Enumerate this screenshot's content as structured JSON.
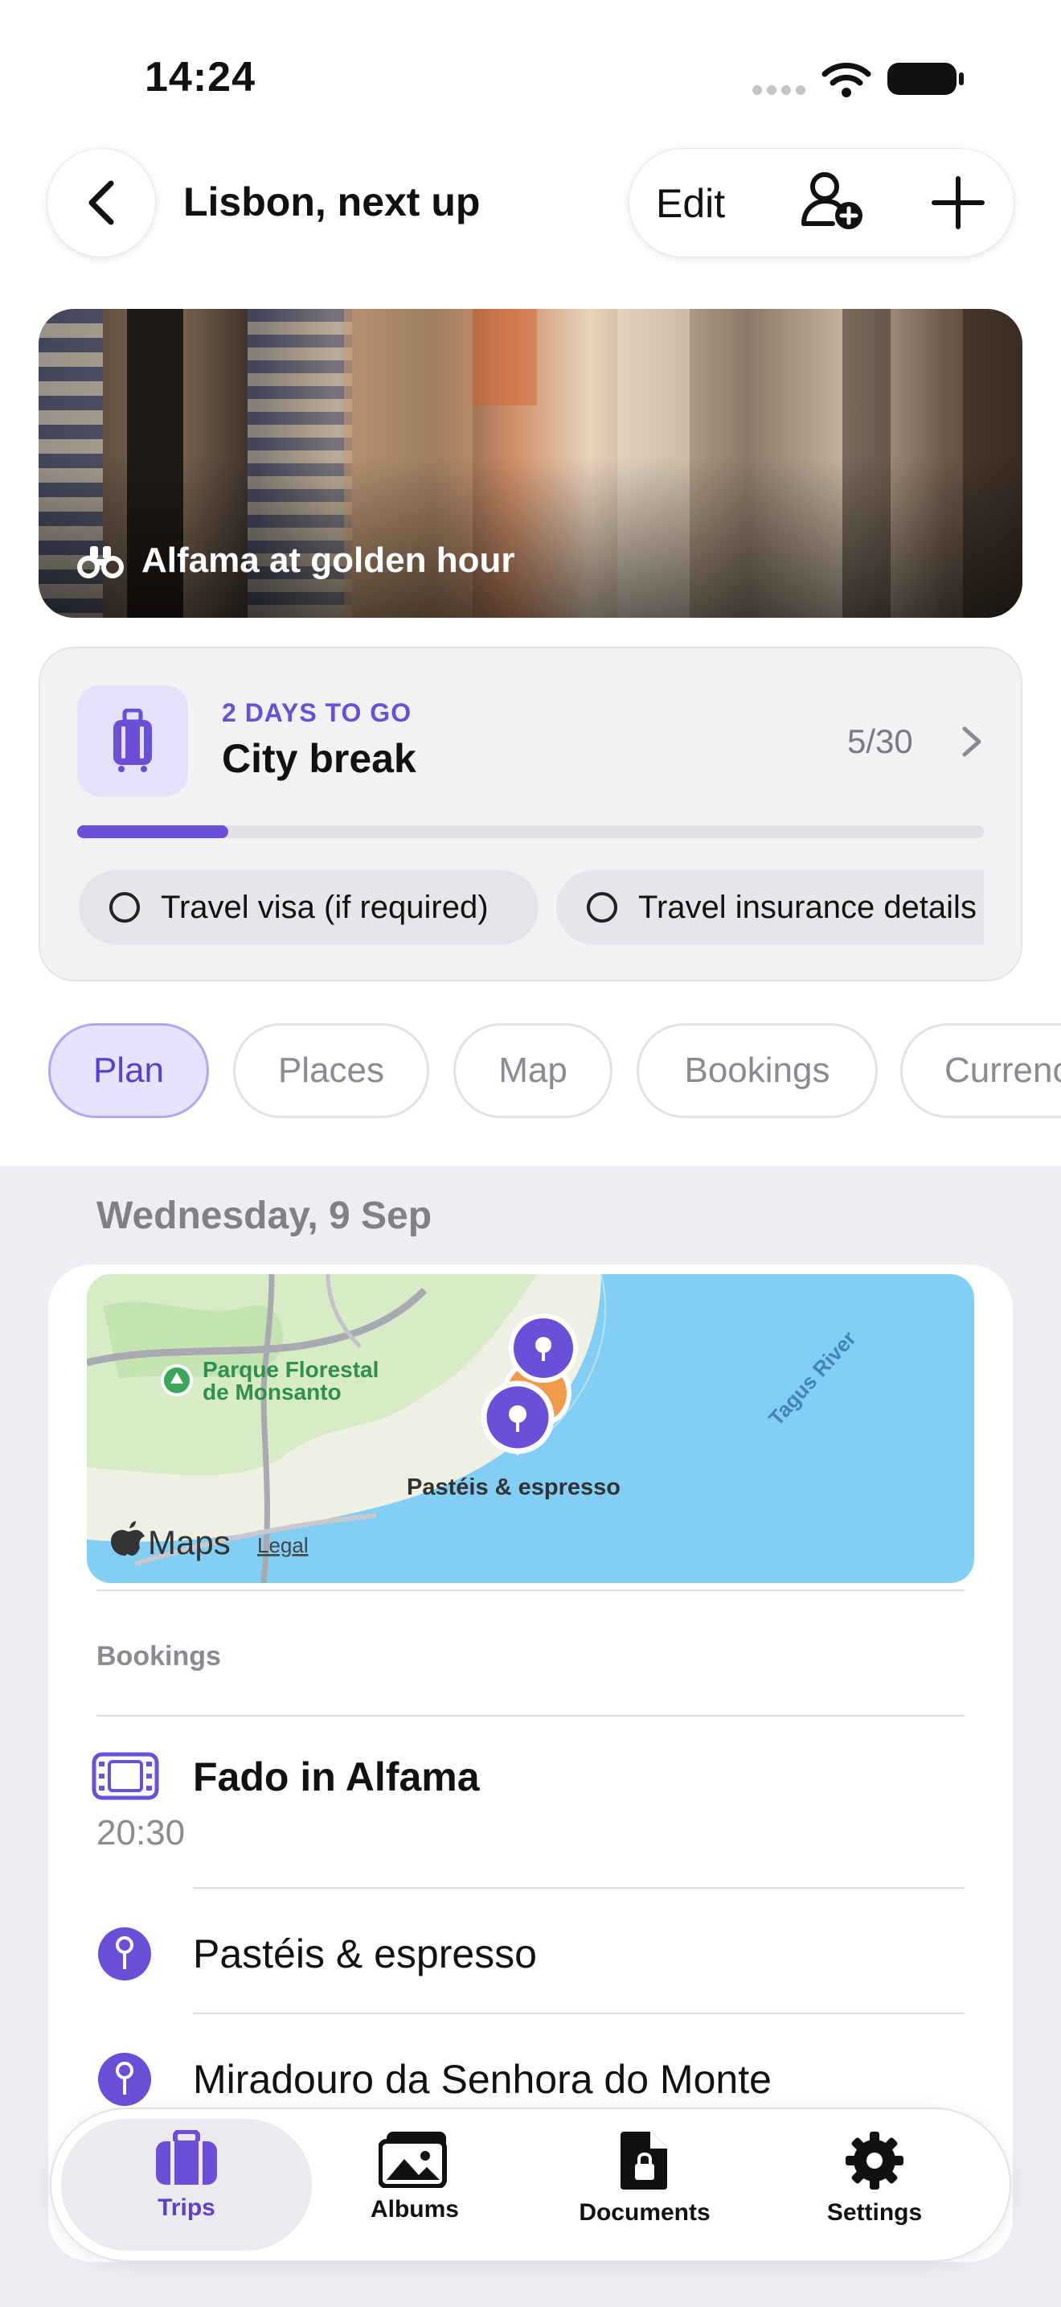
{
  "status_bar": {
    "time": "14:24"
  },
  "header": {
    "title": "Lisbon, next up",
    "edit_label": "Edit"
  },
  "hero": {
    "caption": "Alfama at golden hour"
  },
  "countdown": {
    "label": "2 DAYS TO GO",
    "trip_name": "City break",
    "progress_text": "5/30",
    "progress_fraction": 0.167,
    "chips": [
      {
        "label": "Travel visa (if required)"
      },
      {
        "label": "Travel insurance details"
      }
    ]
  },
  "tabs": [
    {
      "label": "Plan",
      "active": true
    },
    {
      "label": "Places",
      "active": false
    },
    {
      "label": "Map",
      "active": false
    },
    {
      "label": "Bookings",
      "active": false
    },
    {
      "label": "Currency",
      "active": false
    }
  ],
  "day": {
    "heading": "Wednesday, 9 Sep",
    "map": {
      "park_label_line1": "Parque Florestal",
      "park_label_line2": "de Monsanto",
      "river_label": "Tagus River",
      "pin_label": "Pastéis & espresso",
      "maps_brand": "Maps",
      "legal": "Legal"
    },
    "section_label": "Bookings",
    "booking": {
      "title": "Fado in Alfama",
      "time": "20:30"
    },
    "places": [
      {
        "title": "Pastéis & espresso"
      },
      {
        "title": "Miradouro da Senhora do Monte"
      }
    ]
  },
  "tabbar": {
    "items": [
      {
        "label": "Trips",
        "active": true
      },
      {
        "label": "Albums",
        "active": false
      },
      {
        "label": "Documents",
        "active": false
      },
      {
        "label": "Settings",
        "active": false
      }
    ]
  },
  "colors": {
    "accent": "#6a4fd8",
    "accent_light": "#e8e3fc",
    "content_background": "#eeedf3",
    "water": "#7fcdf3"
  }
}
